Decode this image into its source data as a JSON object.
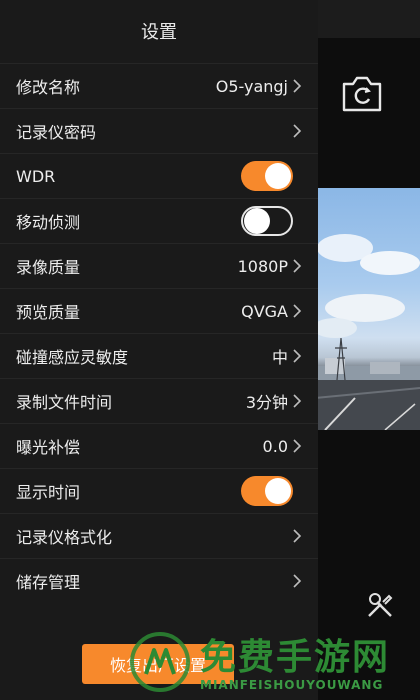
{
  "header": {
    "title": "设置"
  },
  "settings": {
    "rows": [
      {
        "label": "修改名称",
        "value": "O5-yangj"
      },
      {
        "label": "记录仪密码",
        "value": ""
      },
      {
        "label": "WDR",
        "toggle": "on"
      },
      {
        "label": "移动侦测",
        "toggle": "off"
      },
      {
        "label": "录像质量",
        "value": "1080P"
      },
      {
        "label": "预览质量",
        "value": "QVGA"
      },
      {
        "label": "碰撞感应灵敏度",
        "value": "中"
      },
      {
        "label": "录制文件时间",
        "value": "3分钟"
      },
      {
        "label": "曝光补偿",
        "value": "0.0"
      },
      {
        "label": "显示时间",
        "toggle": "on"
      },
      {
        "label": "记录仪格式化",
        "value": ""
      },
      {
        "label": "储存管理",
        "value": ""
      }
    ]
  },
  "footer": {
    "reset_label": "恢复出厂设置"
  },
  "watermark": {
    "title": "免费手游网",
    "subtitle": "MIANFEISHOUYOUWANG"
  },
  "colors": {
    "accent": "#f7892c",
    "panel_bg": "#1a1a1a",
    "watermark": "#2d8a34"
  },
  "icons": {
    "camera": "camera-switch-icon",
    "tools": "tools-icon",
    "chevron": "chevron-right-icon"
  }
}
